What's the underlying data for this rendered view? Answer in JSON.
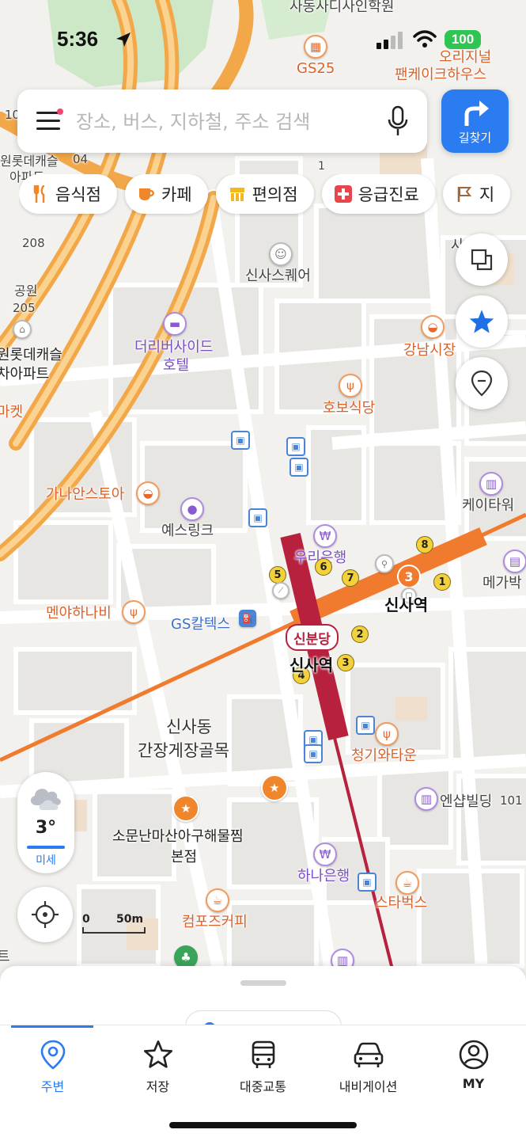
{
  "status_bar": {
    "time": "5:36",
    "battery": "100"
  },
  "search": {
    "placeholder": "장소, 버스, 지하철, 주소 검색"
  },
  "route_button": {
    "label": "길찾기"
  },
  "chips": [
    {
      "label": "음식점",
      "icon": "fork-knife-icon"
    },
    {
      "label": "카페",
      "icon": "coffee-cup-icon"
    },
    {
      "label": "편의점",
      "icon": "store-icon"
    },
    {
      "label": "응급진료",
      "icon": "medical-cross-icon"
    },
    {
      "label": "지",
      "icon": "flag-icon"
    }
  ],
  "map": {
    "labels": {
      "top_school": "사동사디사인학원",
      "gs25": "GS25",
      "original_pancake": "오리지널",
      "pancake_house": "팬케이크하우스",
      "lotte_apt_1": "원롯데캐슬",
      "lotte_apt_2": "아파트",
      "num_04": "04",
      "num_10": "10",
      "num_208": "208",
      "num_205": "205",
      "num_1": "1",
      "park": "공원",
      "lotte_castle_1": "원롯데캐슬",
      "lotte_castle_2": "차아파트",
      "market": "마켓",
      "sinsa_square": "신사스퀘어",
      "sinsa_gil": "사의길",
      "riverside_hotel_1": "더리버사이드",
      "riverside_hotel_2": "호텔",
      "gangnam_market": "강남시장",
      "hobo_restaurant": "호보식당",
      "gana_antoa": "가나안스토아",
      "yes_link": "예스링크",
      "k_tower": "케이타워",
      "woori_bank": "우리은행",
      "megabox": "메가박",
      "sinsa_station_line3": "신사역",
      "menya_hanabi": "멘야하나비",
      "gs_caltex": "GS칼텍스",
      "sinbundang_badge": "신분당",
      "sinsa_station_sbd": "신사역",
      "sinsadong_1": "신사동",
      "sinsadong_2": "간장게장골목",
      "cheonggiwa_town": "청기와타운",
      "nsap_building": "엔샵빌딩",
      "num_101": "101",
      "somunnan_1": "소문난마산아구해물찜",
      "somunnan_2": "본점",
      "hana_bank": "하나은행",
      "starbucks": "스타벅스",
      "compose_coffee": "컴포즈커피",
      "edge_t": "트"
    },
    "line3_station_badge": "3",
    "exits": [
      "1",
      "2",
      "3",
      "4",
      "5",
      "6",
      "7",
      "8"
    ],
    "colors": {
      "line3": "#f07b2f",
      "sinbundang": "#b8213e",
      "road_major": "#f5b04a"
    }
  },
  "weather": {
    "temperature": "3°",
    "dust": "미세"
  },
  "scale": {
    "zero": "0",
    "distance": "50m"
  },
  "tabs": [
    {
      "label": "주변",
      "icon": "location-pin-icon",
      "active": true
    },
    {
      "label": "저장",
      "icon": "star-icon"
    },
    {
      "label": "대중교통",
      "icon": "bus-icon"
    },
    {
      "label": "내비게이션",
      "icon": "car-icon"
    },
    {
      "label": "MY",
      "icon": "user-icon"
    }
  ]
}
